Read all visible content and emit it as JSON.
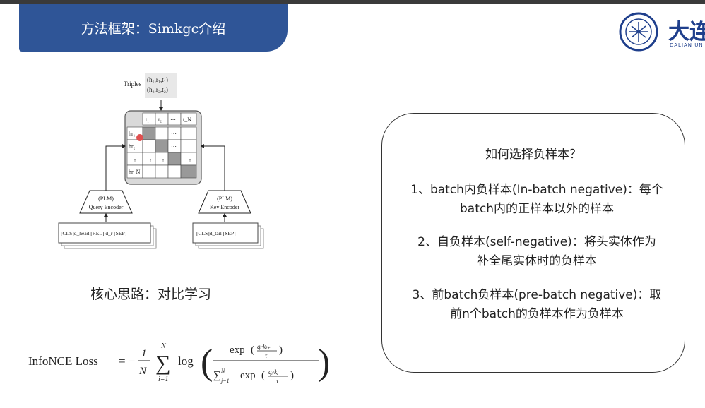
{
  "header": {
    "title": "方法框架：Simkgc介绍"
  },
  "logo": {
    "name": "大连",
    "sub": "DALIAN UNIV"
  },
  "diagram": {
    "triples_label": "Triples",
    "triple1": "(h₁,r₁,t₁)",
    "triple2": "(h₂,r₂,t₂)",
    "dots": "⋯",
    "col_headers": [
      "t₁",
      "t₂",
      "⋯",
      "t_N"
    ],
    "row_headers": [
      "hr₁",
      "hr₂",
      "⋮",
      "hr_N"
    ],
    "query_encoder": [
      "(PLM)",
      "Query Encoder"
    ],
    "key_encoder": [
      "(PLM)",
      "Key Encoder"
    ],
    "query_input": "[CLS]d_head [REL] d_r [SEP]",
    "key_input": "[CLS]d_tail [SEP]"
  },
  "caption": "核心思路：对比学习",
  "formula": {
    "label": "InfoNCE Loss"
  },
  "box": {
    "question": "如何选择负样本？",
    "items": [
      [
        "1、batch内负样本(In-batch negative)：每个",
        "batch内的正样本以外的样本"
      ],
      [
        "2、自负样本(self-negative)：将头实体作为",
        "补全尾实体时的负样本"
      ],
      [
        "3、前batch负样本(pre-batch negative)：取",
        "前n个batch的负样本作为负样本"
      ]
    ]
  }
}
